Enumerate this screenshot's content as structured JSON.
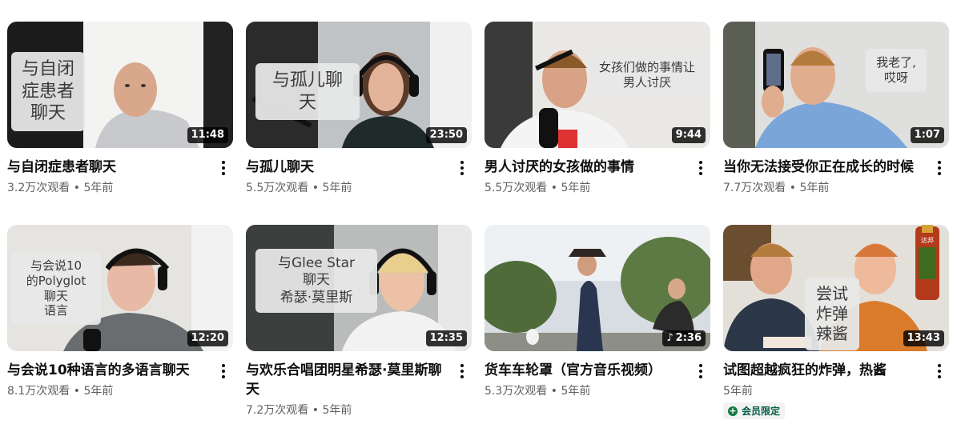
{
  "videos": [
    {
      "overlay": "与自闭\n症患者\n聊天",
      "duration": "11:48",
      "title": "与自闭症患者聊天",
      "views": "3.2万次观看",
      "age": "5年前"
    },
    {
      "overlay": "与孤儿聊\n天",
      "duration": "23:50",
      "title": "与孤儿聊天",
      "views": "5.5万次观看",
      "age": "5年前"
    },
    {
      "overlay": "女孩们做的事情让\n男人讨厌",
      "duration": "9:44",
      "title": "男人讨厌的女孩做的事情",
      "views": "5.5万次观看",
      "age": "5年前"
    },
    {
      "overlay": "我老了,\n哎呀",
      "duration": "1:07",
      "title": "当你无法接受你正在成长的时候",
      "views": "7.7万次观看",
      "age": "5年前"
    },
    {
      "overlay": "与会说10\n的Polyglot\n聊天\n语言",
      "duration": "12:20",
      "title": "与会说10种语言的多语言聊天",
      "views": "8.1万次观看",
      "age": "5年前"
    },
    {
      "overlay": "与Glee Star\n聊天\n希瑟·莫里斯",
      "duration": "12:35",
      "title": "与欢乐合唱团明星希瑟·莫里斯聊天",
      "views": "7.2万次观看",
      "age": "5年前"
    },
    {
      "overlay": "",
      "duration": "2:36",
      "title": "货车车轮罩（官方音乐视频）",
      "views": "5.3万次观看",
      "age": "5年前"
    },
    {
      "overlay": "尝试\n炸弹\n辣酱",
      "duration": "13:43",
      "title": "试图超越疯狂的炸弹，热酱",
      "views": "",
      "age": "5年前",
      "badge": "会员限定",
      "bottle_label": "达邦"
    }
  ],
  "separator": " • ",
  "colors": {
    "duration_bg": "#000000",
    "member_badge": "#107c41"
  }
}
